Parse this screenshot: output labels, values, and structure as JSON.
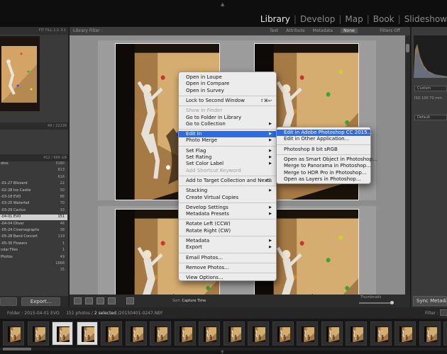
{
  "modules": {
    "items": [
      {
        "label": "Library",
        "active": true
      },
      {
        "label": "Develop",
        "active": false
      },
      {
        "label": "Map",
        "active": false
      },
      {
        "label": "Book",
        "active": false
      },
      {
        "label": "Slideshow",
        "active": false
      }
    ],
    "separator": "|"
  },
  "navigator": {
    "fit_options": "FIT   FILL   1:1   3:1"
  },
  "left_panel": {
    "catalog_counts": "49 / 22238",
    "folders_counts": "412 / 666 GB",
    "folders": [
      {
        "label": "otos",
        "count": "3160"
      },
      {
        "label": "",
        "count": "813"
      },
      {
        "label": "",
        "count": "616"
      },
      {
        "label": "-01-27 Blizzard",
        "count": "22"
      },
      {
        "label": "-02-28 Ice Castle",
        "count": "50"
      },
      {
        "label": "-03-18 EVO",
        "count": "86"
      },
      {
        "label": "-03-20 Waterfall",
        "count": "70"
      },
      {
        "label": "-03-29 Cactus",
        "count": "33"
      },
      {
        "label": "-04-01 EVO",
        "count": "151",
        "selected": true
      },
      {
        "label": "-04-04 Oliver",
        "count": "46"
      },
      {
        "label": "-05-24 Cinemagraphs",
        "count": "38"
      },
      {
        "label": "-05-28 Band Concert",
        "count": "119"
      },
      {
        "label": "-05-30 Flowers",
        "count": "1"
      },
      {
        "label": "ndar Files",
        "count": "1"
      },
      {
        "label": "Photos",
        "count": "49"
      },
      {
        "label": "",
        "count": "1668"
      },
      {
        "label": "",
        "count": "15"
      }
    ],
    "export_label": "Export..."
  },
  "library_filter": {
    "label": "Library Filter :",
    "options": [
      "Text",
      "Attribute",
      "Metadata",
      "None"
    ],
    "active": "None",
    "filters_off": "Filters Off"
  },
  "toolbar": {
    "sort_label": "Sort:",
    "sort_value": "Capture Time",
    "thumbnails_label": "Thumbnails"
  },
  "right_panel": {
    "histogram_text": "ISO 100     70 mm",
    "preset_custom": "Custom",
    "preset_default": "Default",
    "sync_label": "Sync Metadata"
  },
  "path_bar": {
    "folder": "Folder : 2015-04-01 EVO",
    "counts": "151 photos /",
    "selected": "2 selected",
    "file": "/20150401-0247.NEF",
    "filter_label": "Filter :"
  },
  "context_menu": {
    "groups": [
      [
        {
          "label": "Open in Loupe"
        },
        {
          "label": "Open in Compare"
        },
        {
          "label": "Open in Survey"
        }
      ],
      [
        {
          "label": "Lock to Second Window",
          "shortcut": "⇧⌘↩"
        }
      ],
      [
        {
          "label": "Show in Finder",
          "disabled": true
        },
        {
          "label": "Go to Folder in Library"
        },
        {
          "label": "Go to Collection",
          "submenu": true
        }
      ],
      [
        {
          "label": "Edit In",
          "submenu": true,
          "highlighted": true
        },
        {
          "label": "Photo Merge",
          "submenu": true
        }
      ],
      [
        {
          "label": "Set Flag",
          "submenu": true
        },
        {
          "label": "Set Rating",
          "submenu": true
        },
        {
          "label": "Set Color Label",
          "submenu": true
        },
        {
          "label": "Add Shortcut Keyword",
          "disabled": true
        }
      ],
      [
        {
          "label": "Add to Target Collection and Next",
          "shortcut": "⇧B"
        }
      ],
      [
        {
          "label": "Stacking",
          "submenu": true
        },
        {
          "label": "Create Virtual Copies"
        }
      ],
      [
        {
          "label": "Develop Settings",
          "submenu": true
        },
        {
          "label": "Metadata Presets",
          "submenu": true
        }
      ],
      [
        {
          "label": "Rotate Left (CCW)"
        },
        {
          "label": "Rotate Right (CW)"
        }
      ],
      [
        {
          "label": "Metadata",
          "submenu": true
        },
        {
          "label": "Export",
          "submenu": true
        }
      ],
      [
        {
          "label": "Email Photos..."
        }
      ],
      [
        {
          "label": "Remove Photos..."
        }
      ],
      [
        {
          "label": "View Options..."
        }
      ]
    ]
  },
  "submenu": {
    "groups": [
      [
        {
          "label": "Edit in Adobe Photoshop CC 2015...",
          "highlighted": true
        },
        {
          "label": "Edit in Other Application..."
        }
      ],
      [
        {
          "label": "Photoshop 8 bit sRGB"
        }
      ],
      [
        {
          "label": "Open as Smart Object in Photoshop..."
        },
        {
          "label": "Merge to Panorama in Photoshop..."
        },
        {
          "label": "Merge to HDR Pro in Photoshop..."
        },
        {
          "label": "Open as Layers in Photoshop..."
        }
      ]
    ]
  },
  "colors": {
    "menu_highlight": "#2d6de0",
    "menu_bg": "#ececec",
    "grid_bg": "#8d8d8d"
  }
}
